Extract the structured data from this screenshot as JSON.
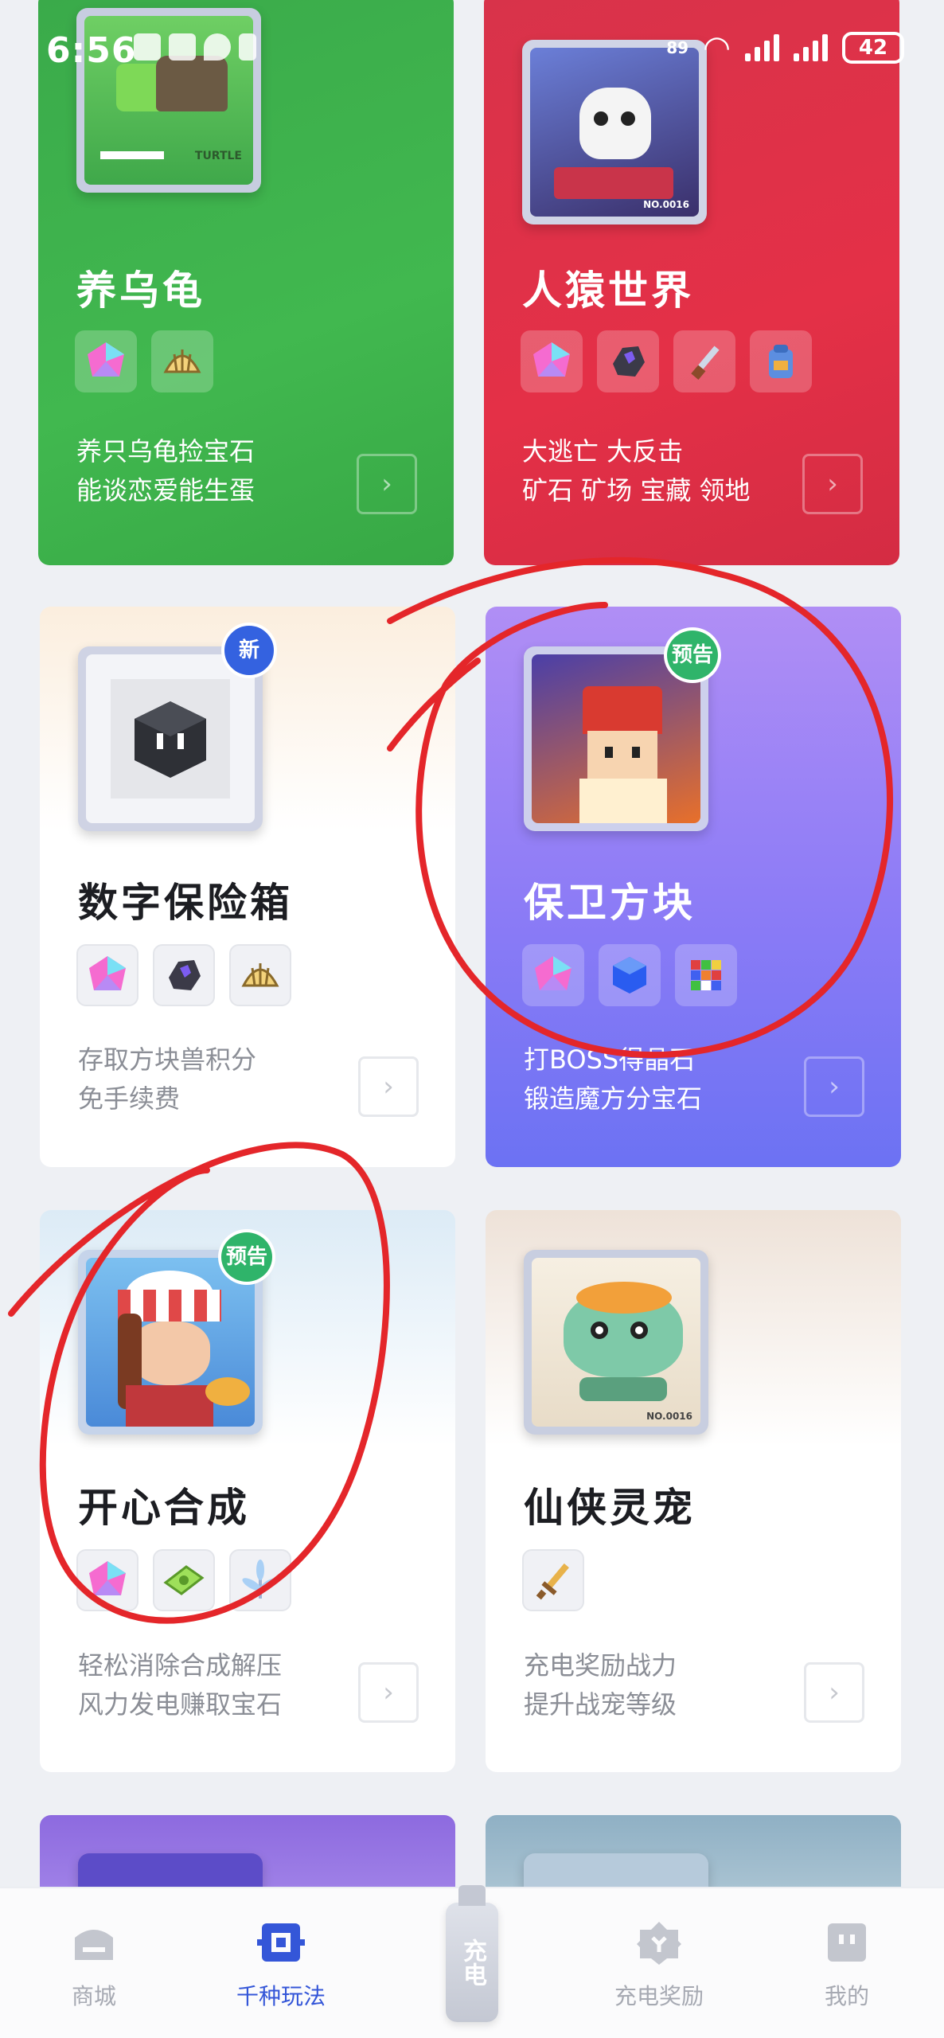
{
  "status_bar": {
    "time": "6:56",
    "network_speed": "89",
    "battery": "42"
  },
  "cards": [
    {
      "id": "turtle",
      "title": "养乌龟",
      "desc_line1": "养只乌龟捡宝石",
      "desc_line2": "能谈恋爱能生蛋",
      "gems": [
        "crystal-gem-icon",
        "shell-icon"
      ],
      "thumb_label": "TURTLE",
      "accent": "#3aaa4a"
    },
    {
      "id": "ape",
      "title": "人猿世界",
      "desc_line1": "大逃亡 大反击",
      "desc_line2": "矿石 矿场 宝藏 领地",
      "gems": [
        "crystal-gem-icon",
        "ore-icon",
        "dagger-icon",
        "backpack-icon"
      ],
      "thumb_label": "NO.0016",
      "accent": "#e03048"
    },
    {
      "id": "vault",
      "title": "数字保险箱",
      "desc_line1": "存取方块兽积分",
      "desc_line2": "免手续费",
      "gems": [
        "crystal-gem-icon",
        "ore-icon",
        "shell-icon"
      ],
      "badge": "新"
    },
    {
      "id": "defend",
      "title": "保卫方块",
      "desc_line1": "打BOSS得晶石",
      "desc_line2": "锻造魔方分宝石",
      "gems": [
        "crystal-gem-icon",
        "blue-cube-icon",
        "rubik-cube-icon"
      ],
      "badge": "预告",
      "accent": "#8b7bf6"
    },
    {
      "id": "merge",
      "title": "开心合成",
      "desc_line1": "轻松消除合成解压",
      "desc_line2": "风力发电赚取宝石",
      "gems": [
        "crystal-gem-icon",
        "cash-icon",
        "windmill-icon"
      ],
      "badge": "预告"
    },
    {
      "id": "pet",
      "title": "仙侠灵宠",
      "desc_line1": "充电奖励战力",
      "desc_line2": "提升战宠等级",
      "gems": [
        "sword-icon"
      ],
      "thumb_label": "NO.0016"
    }
  ],
  "bottom_nav": {
    "items": [
      {
        "label": "商城",
        "icon": "shop-icon"
      },
      {
        "label": "千种玩法",
        "icon": "games-icon"
      },
      {
        "label": "充电",
        "icon": "charger-icon"
      },
      {
        "label": "充电奖励",
        "icon": "reward-icon"
      },
      {
        "label": "我的",
        "icon": "profile-icon"
      }
    ],
    "active": "千种玩法",
    "active_color": "#3456d8"
  }
}
